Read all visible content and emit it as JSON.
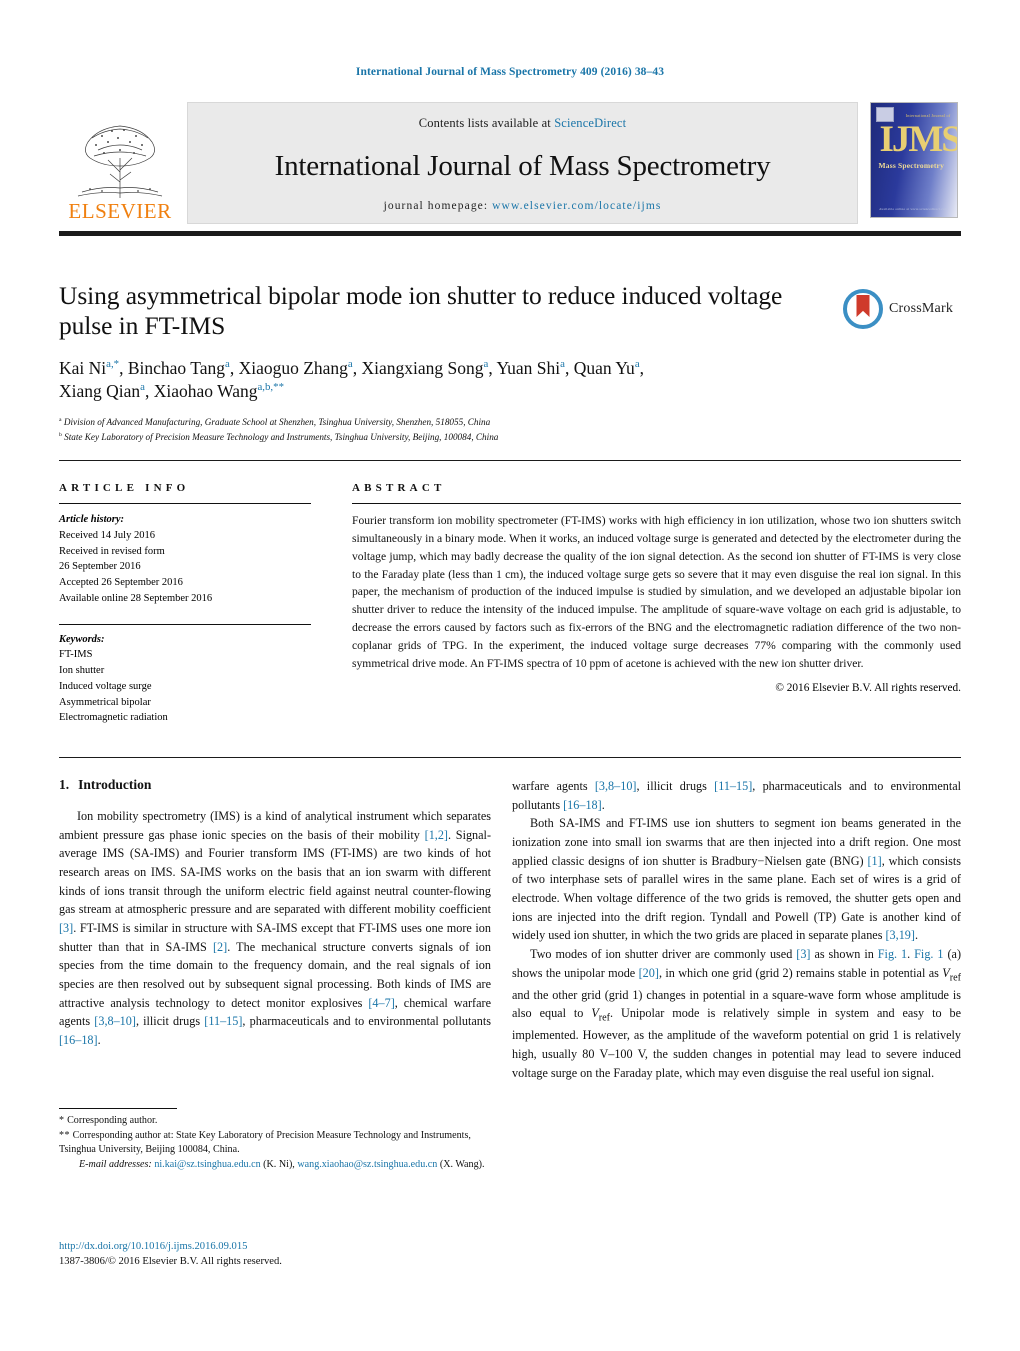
{
  "running_head": "International Journal of Mass Spectrometry 409 (2016) 38–43",
  "masthead": {
    "publisher_logo_text": "ELSEVIER",
    "contents_prefix": "Contents lists available at ",
    "contents_link": "ScienceDirect",
    "journal_title": "International Journal of Mass Spectrometry",
    "homepage_prefix": "journal homepage: ",
    "homepage_url": "www.elsevier.com/locate/ijms",
    "cover": {
      "top_label": "International Journal of",
      "wordmark": "IJMS",
      "subtitle": "Mass Spectrometry",
      "bottom_label": "Available online at www.sciencedirect.com"
    }
  },
  "article": {
    "title": "Using asymmetrical bipolar mode ion shutter to reduce induced voltage pulse in FT-IMS",
    "authors_line1_html": "Kai Ni<sup>a,*</sup>, Binchao Tang<sup>a</sup>, Xiaoguo Zhang<sup>a</sup>, Xiangxiang Song<sup>a</sup>, Yuan Shi<sup>a</sup>, Quan Yu<sup>a</sup>,",
    "authors_line2_html": "Xiang Qian<sup>a</sup>, Xiaohao Wang<sup>a,b,**</sup>",
    "affiliation_a": "Division of Advanced Manufacturing, Graduate School at Shenzhen, Tsinghua University, Shenzhen, 518055, China",
    "affiliation_b": "State Key Laboratory of Precision Measure Technology and Instruments, Tsinghua University, Beijing, 100084, China",
    "crossmark_label": "CrossMark"
  },
  "article_info": {
    "heading": "ARTICLE INFO",
    "history_title": "Article history:",
    "history": [
      "Received 14 July 2016",
      "Received in revised form",
      "26 September 2016",
      "Accepted 26 September 2016",
      "Available online 28 September 2016"
    ],
    "keywords_title": "Keywords:",
    "keywords": [
      "FT-IMS",
      "Ion shutter",
      "Induced voltage surge",
      "Asymmetrical bipolar",
      "Electromagnetic radiation"
    ]
  },
  "abstract": {
    "heading": "ABSTRACT",
    "text": "Fourier transform ion mobility spectrometer (FT-IMS) works with high efficiency in ion utilization, whose two ion shutters switch simultaneously in a binary mode. When it works, an induced voltage surge is generated and detected by the electrometer during the voltage jump, which may badly decrease the quality of the ion signal detection. As the second ion shutter of FT-IMS is very close to the Faraday plate (less than 1 cm), the induced voltage surge gets so severe that it may even disguise the real ion signal. In this paper, the mechanism of production of the induced impulse is studied by simulation, and we developed an adjustable bipolar ion shutter driver to reduce the intensity of the induced impulse. The amplitude of square-wave voltage on each grid is adjustable, to decrease the errors caused by factors such as fix-errors of the BNG and the electromagnetic radiation difference of the two non-coplanar grids of TPG. In the experiment, the induced voltage surge decreases 77% comparing with the commonly used symmetrical drive mode. An FT-IMS spectra of 10 ppm of acetone is achieved with the new ion shutter driver.",
    "copyright": "© 2016 Elsevier B.V. All rights reserved."
  },
  "body": {
    "section_number": "1.",
    "section_title": "Introduction",
    "left_paragraph_1_html": "Ion mobility spectrometry (IMS) is a kind of analytical instrument which separates ambient pressure gas phase ionic species on the basis of their mobility <span class=\"ref\">[1,2]</span>. Signal-average IMS (SA-IMS) and Fourier transform IMS (FT-IMS) are two kinds of hot research areas on IMS. SA-IMS works on the basis that an ion swarm with different kinds of ions transit through the uniform electric field against neutral counter-flowing gas stream at atmospheric pressure and are separated with different mobility coefficient <span class=\"ref\">[3]</span>. FT-IMS is similar in structure with SA-IMS except that FT-IMS uses one more ion shutter than that in SA-IMS <span class=\"ref\">[2]</span>. The mechanical structure converts signals of ion species from the time domain to the frequency domain, and the real signals of ion species are then resolved out by subsequent signal processing. Both kinds of IMS are attractive analysis technology to detect monitor explosives <span class=\"ref\">[4–7]</span>, chemical warfare agents <span class=\"ref\">[3,8–10]</span>, illicit drugs <span class=\"ref\">[11–15]</span>, pharmaceuticals and to environmental pollutants <span class=\"ref\">[16–18]</span>.",
    "right_paragraph_1_html": "warfare agents <span class=\"ref\">[3,8–10]</span>, illicit drugs <span class=\"ref\">[11–15]</span>, pharmaceuticals and to environmental pollutants <span class=\"ref\">[16–18]</span>.",
    "right_paragraph_2_html": "Both SA-IMS and FT-IMS use ion shutters to segment ion beams generated in the ionization zone into small ion swarms that are then injected into a drift region. One most applied classic designs of ion shutter is Bradbury−Nielsen gate (BNG) <span class=\"ref\">[1]</span>, which consists of two interphase sets of parallel wires in the same plane. Each set of wires is a grid of electrode. When voltage difference of the two grids is removed, the shutter gets open and ions are injected into the drift region. Tyndall and Powell (TP) Gate is another kind of widely used ion shutter, in which the two grids are placed in separate planes <span class=\"ref\">[3,19]</span>.",
    "right_paragraph_3_html": "Two modes of ion shutter driver are commonly used <span class=\"ref\">[3]</span> as shown in <span class=\"xref\">Fig. 1</span>. <span class=\"xref\">Fig. 1</span> (a) shows the unipolar mode <span class=\"ref\">[20]</span>, in which one grid (grid 2) remains stable in potential as <i>V</i><sub>ref</sub> and the other grid (grid 1) changes in potential in a square-wave form whose amplitude is also equal to <i>V</i><sub>ref</sub>. Unipolar mode is relatively simple in system and easy to be implemented. However, as the amplitude of the waveform potential on grid 1 is relatively high, usually 80 V–100 V, the sudden changes in potential may lead to severe induced voltage surge on the Faraday plate, which may even disguise the real useful ion signal."
  },
  "footnotes": {
    "line1_html": "<span class=\"star\">*</span> Corresponding author.",
    "line2_html": "<span class=\"star\">**</span> Corresponding author at: State Key Laboratory of Precision Measure Technology and Instruments, Tsinghua University, Beijing 100084, China.",
    "emails_label": "E-mail addresses:",
    "email1": "ni.kai@sz.tsinghua.edu.cn",
    "email1_owner": "(K. Ni),",
    "email2": "wang.xiaohao@sz.tsinghua.edu.cn",
    "email2_owner": "(X. Wang).",
    "doi": "http://dx.doi.org/10.1016/j.ijms.2016.09.015",
    "issn_line": "1387-3806/© 2016 Elsevier B.V. All rights reserved."
  },
  "colors": {
    "link": "#1a75a8",
    "elsevier_orange": "#f08010",
    "crossmark_blue": "#3b8fc4",
    "crossmark_red": "#cf3a2b"
  }
}
